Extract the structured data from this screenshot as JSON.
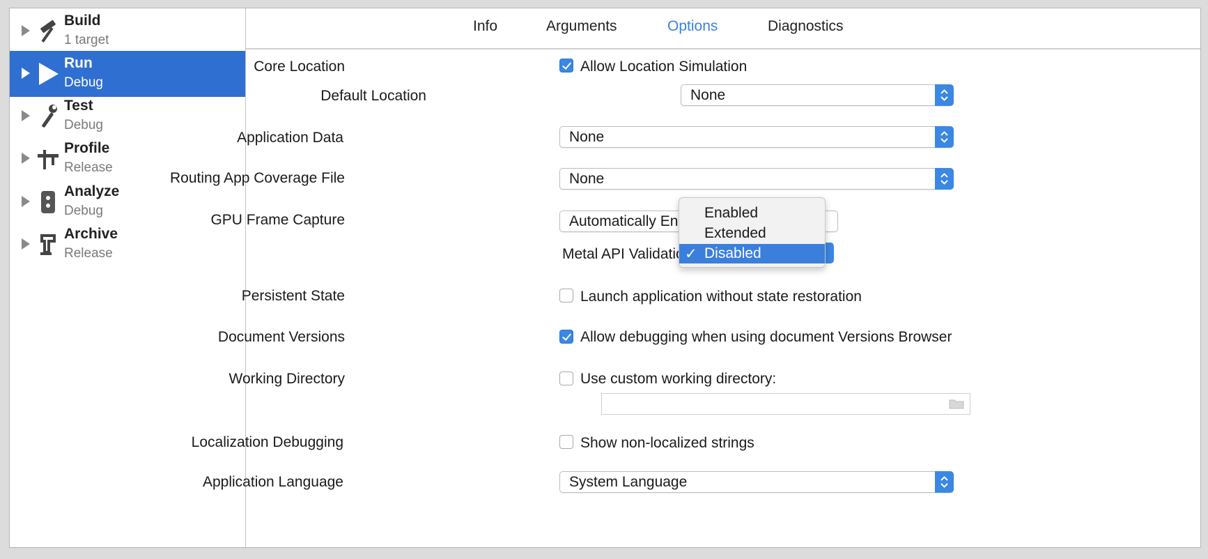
{
  "sidebar": {
    "items": [
      {
        "title": "Build",
        "subtitle": "1 target",
        "icon": "hammer-icon"
      },
      {
        "title": "Run",
        "subtitle": "Debug",
        "icon": "play-icon"
      },
      {
        "title": "Test",
        "subtitle": "Debug",
        "icon": "wrench-icon"
      },
      {
        "title": "Profile",
        "subtitle": "Release",
        "icon": "instruments-icon"
      },
      {
        "title": "Analyze",
        "subtitle": "Debug",
        "icon": "analyze-icon"
      },
      {
        "title": "Archive",
        "subtitle": "Release",
        "icon": "archive-icon"
      }
    ],
    "selected": "Run"
  },
  "tabs": [
    "Info",
    "Arguments",
    "Options",
    "Diagnostics"
  ],
  "active_tab": "Options",
  "options": {
    "core_location": {
      "label": "Core Location",
      "checkbox_label": "Allow Location Simulation",
      "checked": true
    },
    "default_location": {
      "label": "Default Location",
      "value": "None"
    },
    "application_data": {
      "label": "Application Data",
      "value": "None"
    },
    "routing_coverage": {
      "label": "Routing App Coverage File",
      "value": "None"
    },
    "gpu_frame_capture": {
      "label": "GPU Frame Capture",
      "value": "Automatically Ena"
    },
    "metal_api": {
      "label": "Metal API Validatio"
    },
    "persistent_state": {
      "label": "Persistent State",
      "checkbox_label": "Launch application without state restoration",
      "checked": false
    },
    "document_versions": {
      "label": "Document Versions",
      "checkbox_label": "Allow debugging when using document Versions Browser",
      "checked": true
    },
    "working_directory": {
      "label": "Working Directory",
      "checkbox_label": "Use custom working directory:",
      "checked": false
    },
    "localization_debugging": {
      "label": "Localization Debugging",
      "checkbox_label": "Show non-localized strings",
      "checked": false
    },
    "application_language": {
      "label": "Application Language",
      "value": "System Language"
    }
  },
  "metal_menu": {
    "items": [
      "Enabled",
      "Extended",
      "Disabled"
    ],
    "selected": "Disabled",
    "check_mark": "✓"
  },
  "colors": {
    "accent": "#3b87e4",
    "selection": "#2f6fd2",
    "active_tab": "#3a82e0"
  }
}
